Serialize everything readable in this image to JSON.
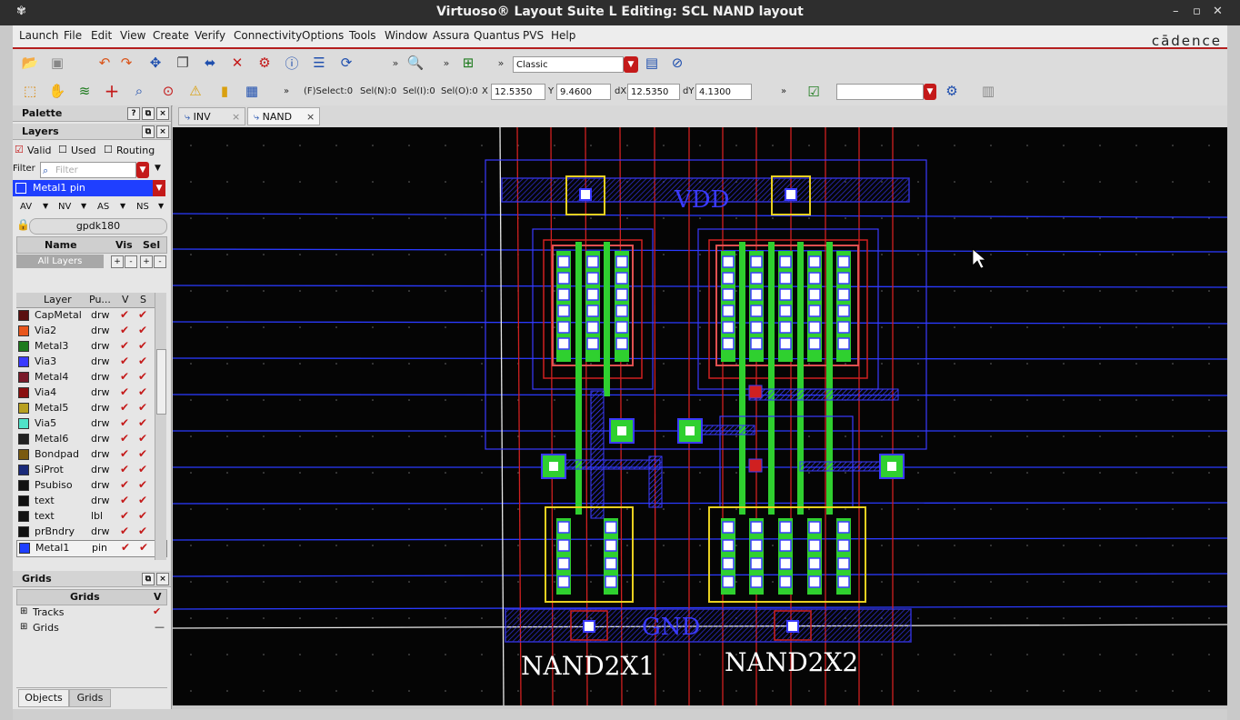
{
  "window": {
    "title": "Virtuoso® Layout Suite L Editing: SCL NAND layout",
    "controls": [
      "–",
      "▫",
      "✕"
    ]
  },
  "menubar": {
    "items": [
      "Launch",
      "File",
      "Edit",
      "View",
      "Create",
      "Verify",
      "Connectivity",
      "Options",
      "Tools",
      "Window",
      "Assura",
      "Quantus",
      "PVS",
      "Help"
    ],
    "brand": "cādence"
  },
  "toolbar1": {
    "workspace": "Classic"
  },
  "toolbar2": {
    "select_mode": "(F)Select:0",
    "sel_n": "Sel(N):0",
    "sel_i": "Sel(I):0",
    "sel_o": "Sel(O):0",
    "x_label": "X",
    "x_value": "12.5350",
    "y_label": "Y",
    "y_value": "9.4600",
    "dx_label": "dX",
    "dx_value": "12.5350",
    "dy_label": "dY",
    "dy_value": "4.1300",
    "overflow": "»"
  },
  "palette": {
    "title": "Palette",
    "layers_title": "Layers",
    "valid_label": "Valid",
    "used_label": "Used",
    "routing_label": "Routing",
    "filter_label": "Filter",
    "filter_placeholder": "Filter",
    "current_layer": "Metal1 pin",
    "current_layer_color": "#1f3fff",
    "visibility_buttons": [
      "AV",
      "NV",
      "AS",
      "NS"
    ],
    "tech_lib": "gpdk180",
    "name_header": "Name",
    "vis_header": "Vis",
    "sel_header": "Sel",
    "all_layers": "All Layers",
    "table_headers": {
      "layer": "Layer",
      "purpose": "Pu...",
      "v": "V",
      "s": "S"
    },
    "layers": [
      {
        "name": "CapMetal",
        "purpose": "drw",
        "color": "#5a1010"
      },
      {
        "name": "Via2",
        "purpose": "drw",
        "color": "#e8561c"
      },
      {
        "name": "Metal3",
        "purpose": "drw",
        "color": "#1c7a1c"
      },
      {
        "name": "Via3",
        "purpose": "drw",
        "color": "#3a3aff"
      },
      {
        "name": "Metal4",
        "purpose": "drw",
        "color": "#7a1a2a"
      },
      {
        "name": "Via4",
        "purpose": "drw",
        "color": "#8a1010"
      },
      {
        "name": "Metal5",
        "purpose": "drw",
        "color": "#b8a020"
      },
      {
        "name": "Via5",
        "purpose": "drw",
        "color": "#4fe3c9"
      },
      {
        "name": "Metal6",
        "purpose": "drw",
        "color": "#222222"
      },
      {
        "name": "Bondpad",
        "purpose": "drw",
        "color": "#7a5a10"
      },
      {
        "name": "SiProt",
        "purpose": "drw",
        "color": "#1a2a7a"
      },
      {
        "name": "Psubiso",
        "purpose": "drw",
        "color": "#111111"
      },
      {
        "name": "text",
        "purpose": "drw",
        "color": "#111111"
      },
      {
        "name": "text",
        "purpose": "lbl",
        "color": "#111111"
      },
      {
        "name": "prBndry",
        "purpose": "drw",
        "color": "#111111"
      },
      {
        "name": "Metal1",
        "purpose": "pin",
        "color": "#1f3fff"
      }
    ]
  },
  "grids_panel": {
    "title": "Grids",
    "header": "Grids",
    "v_header": "V",
    "items": [
      "Tracks",
      "Grids"
    ]
  },
  "bottom_tabs": [
    "Objects",
    "Grids"
  ],
  "tabs": [
    {
      "label": "INV"
    },
    {
      "label": "NAND"
    }
  ],
  "layout": {
    "vdd_label": "VDD",
    "gnd_label": "GND",
    "cell1_label": "NAND2X1",
    "cell2_label": "NAND2X2"
  }
}
